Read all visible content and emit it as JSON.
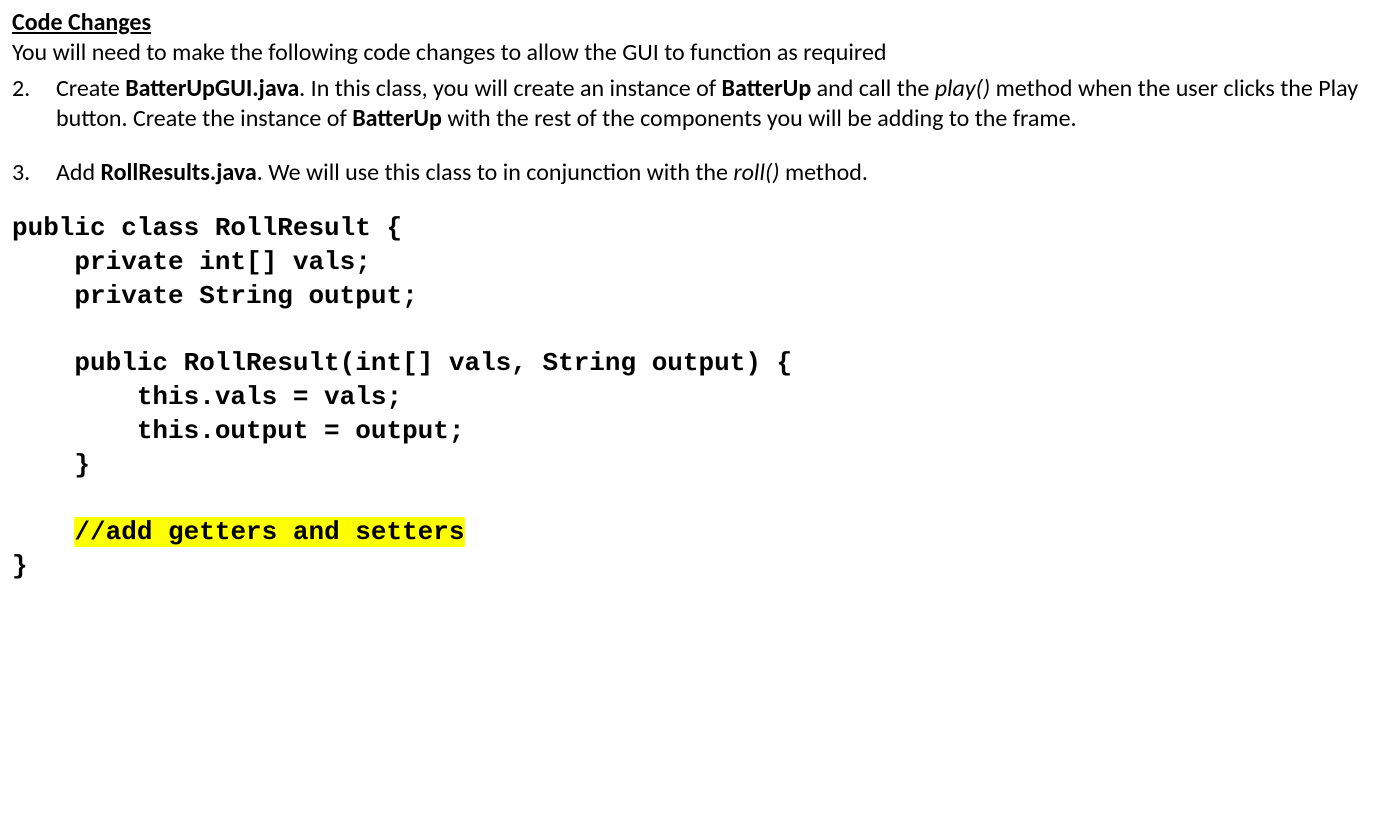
{
  "heading": "Code Changes",
  "intro": "You will need to make the following code changes to allow the GUI to function as required",
  "items": [
    {
      "num": "2.",
      "parts": [
        {
          "t": "Create "
        },
        {
          "t": "BatterUpGUI.java",
          "b": true
        },
        {
          "t": ". In this class, you will create an instance of "
        },
        {
          "t": "BatterUp",
          "b": true
        },
        {
          "t": " and call the "
        },
        {
          "t": "play()",
          "i": true
        },
        {
          "t": " method when the user clicks the Play button. Create the instance of "
        },
        {
          "t": "BatterUp",
          "b": true
        },
        {
          "t": " with the rest of the components you will be adding to the frame."
        }
      ]
    },
    {
      "num": "3.",
      "parts": [
        {
          "t": "Add "
        },
        {
          "t": "RollResults.java",
          "b": true
        },
        {
          "t": ". We will use this class to in conjunction with the "
        },
        {
          "t": "roll()",
          "i": true
        },
        {
          "t": " method."
        }
      ]
    }
  ],
  "code": {
    "l1": "public class RollResult {",
    "l2": "    private int[] vals;",
    "l3": "    private String output;",
    "l4": "",
    "l5": "    public RollResult(int[] vals, String output) {",
    "l6": "        this.vals = vals;",
    "l7": "        this.output = output;",
    "l8": "    }",
    "l9": "",
    "l10p": "    ",
    "l10h": "//add getters and setters",
    "l11": "}"
  }
}
